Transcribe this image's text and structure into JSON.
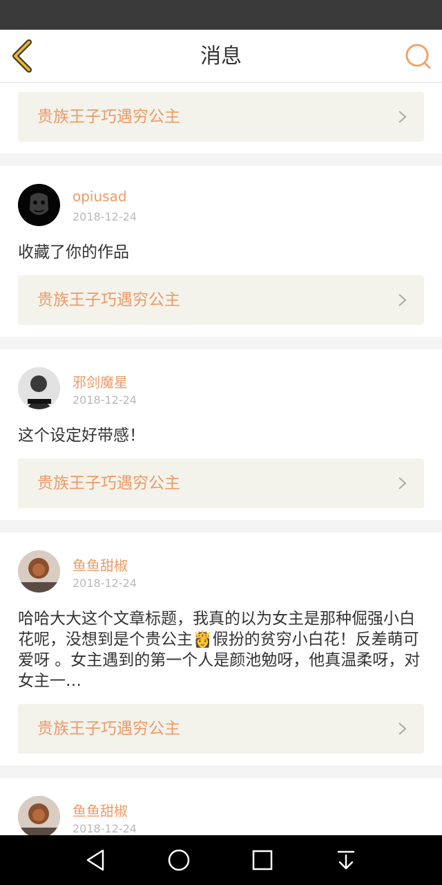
{
  "header": {
    "title": "消息"
  },
  "work_title": "贵族王子巧遇穷公主",
  "messages": [
    {
      "user": "opiusad",
      "date": "2018-12-24",
      "text": "收藏了你的作品",
      "work": "贵族王子巧遇穷公主"
    },
    {
      "user": "邪剑魔星",
      "date": "2018-12-24",
      "text": "这个设定好带感！",
      "work": "贵族王子巧遇穷公主"
    },
    {
      "user": "鱼鱼甜椒",
      "date": "2018-12-24",
      "text": "哈哈大大这个文章标题，我真的以为女主是那种倔强小白花呢，没想到是个贵公主👸假扮的贫穷小白花！反差萌可爱呀 。女主遇到的第一个人是颜池勉呀，他真温柔呀，对女主一…",
      "work": "贵族王子巧遇穷公主"
    },
    {
      "user": "鱼鱼甜椒",
      "date": "2018-12-24"
    }
  ],
  "colors": {
    "accent": "#ee9a66",
    "link_bg": "#f3f3ec",
    "page_bg": "#f4f4f4"
  }
}
